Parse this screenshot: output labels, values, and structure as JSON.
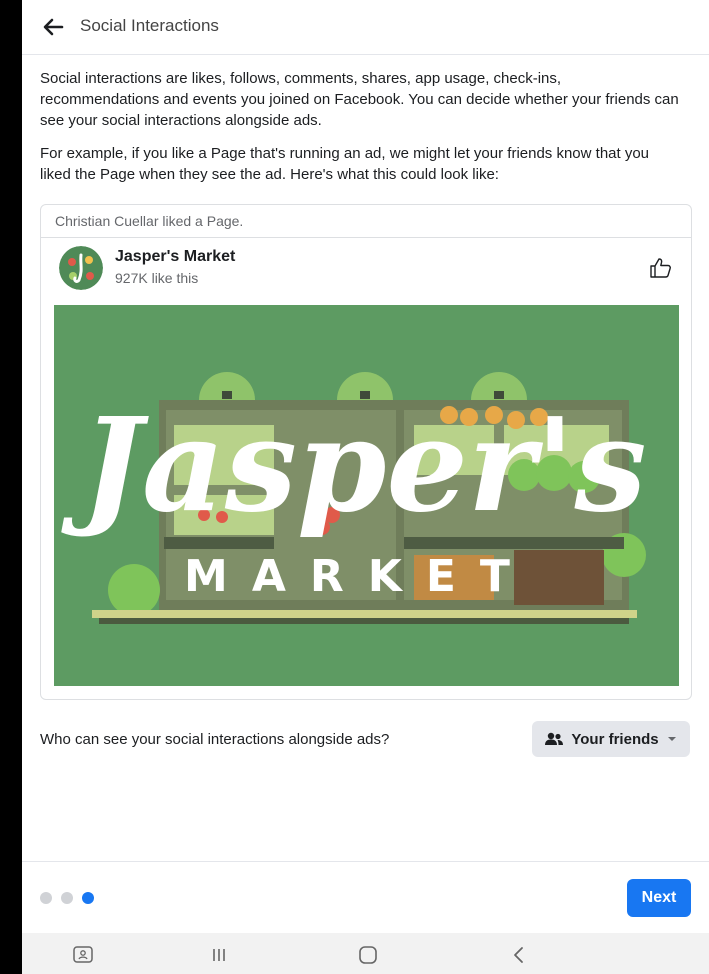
{
  "header": {
    "title": "Social Interactions"
  },
  "intro": {
    "paragraph1": "Social interactions are likes, follows, comments, shares, app usage, check-ins, recommendations and events you joined on Facebook. You can decide whether your friends can see your social interactions alongside ads.",
    "paragraph2": "For example, if you like a Page that's running an ad, we might let your friends know that you liked the Page when they see the ad. Here's what this could look like:"
  },
  "preview": {
    "activity": "Christian Cuellar liked a Page.",
    "page_name": "Jasper's Market",
    "page_likes": "927K like this",
    "ad_logo_title": "Jasper's",
    "ad_logo_subtitle": "MARKET"
  },
  "audience": {
    "question": "Who can see your social interactions alongside ads?",
    "selected": "Your friends"
  },
  "pager": {
    "total": 3,
    "active_index": 2
  },
  "footer": {
    "next_label": "Next"
  },
  "colors": {
    "accent": "#1877f2",
    "ad_background": "#5d9b62"
  }
}
